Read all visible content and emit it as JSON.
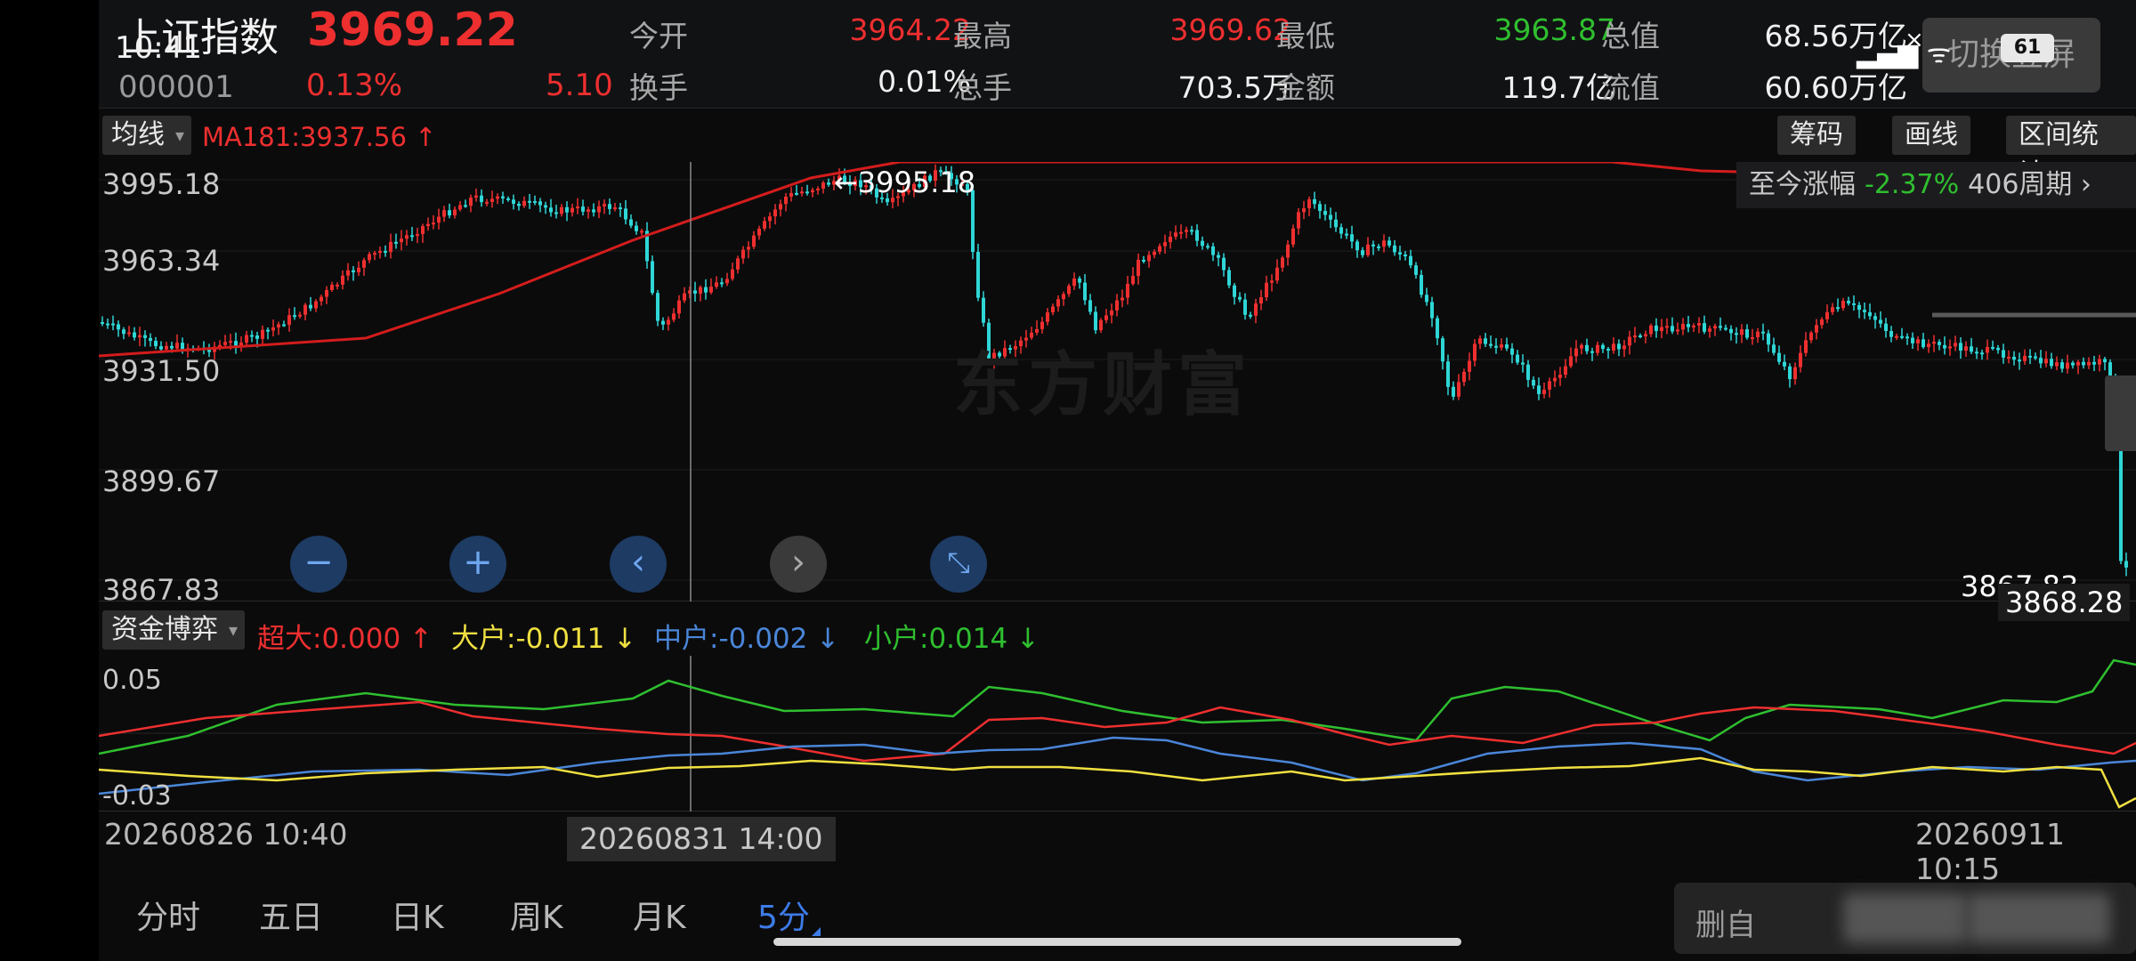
{
  "status_bar": {
    "time": "10:41",
    "battery": "61"
  },
  "header": {
    "name": "上证指数",
    "price": "3969.22",
    "code": "000001",
    "change_pct": "0.13%",
    "change": "5.10",
    "quotes": [
      {
        "label": "今开",
        "value": "3964.22",
        "color": "red"
      },
      {
        "label": "最高",
        "value": "3969.62",
        "color": "red"
      },
      {
        "label": "最低",
        "value": "3963.87",
        "color": "green"
      },
      {
        "label": "总值",
        "value": "68.56万亿",
        "color": "white"
      },
      {
        "label": "换手",
        "value": "0.01%",
        "color": "white"
      },
      {
        "label": "总手",
        "value": "703.5万",
        "color": "white"
      },
      {
        "label": "金额",
        "value": "119.7亿",
        "color": "white"
      },
      {
        "label": "流值",
        "value": "60.60万亿",
        "color": "white"
      }
    ],
    "fullscreen_button": "切换竖屏"
  },
  "toolbar": {
    "ma_button": "均线",
    "ma_label": "MA181:3937.56 ↑",
    "tools": [
      "筹码",
      "画线",
      "区间统计"
    ]
  },
  "main_chart": {
    "y_labels": [
      "3995.18",
      "3963.34",
      "3931.50",
      "3899.67",
      "3867.83"
    ],
    "max_annotation": "←3995.18",
    "low_annotation": "3867.83",
    "current_price_tag": "3868.28",
    "range_change_label": "至今涨幅",
    "range_change_value": "-2.37%",
    "range_period": "406周期 ›",
    "watermark": "东方财富",
    "controls": {
      "zoom_out": "−",
      "zoom_in": "+",
      "prev": "‹",
      "next": "›",
      "collapse": "⤡"
    }
  },
  "indicator": {
    "button": "资金博弈",
    "labels": [
      {
        "text": "超大:0.000 ↑",
        "color": "#ee2f2f"
      },
      {
        "text": "大户:-0.011 ↓",
        "color": "#f0e040"
      },
      {
        "text": "中户:-0.002 ↓",
        "color": "#4a86d8"
      },
      {
        "text": "小户:0.014 ↓",
        "color": "#2fbf2f"
      }
    ],
    "y_labels": [
      "0.05",
      "-0.03"
    ]
  },
  "x_axis": {
    "start": "20260826 10:40",
    "cursor": "20260831 14:00",
    "end": "20260911 10:15"
  },
  "period_tabs": {
    "items": [
      "分时",
      "五日",
      "日K",
      "周K",
      "月K",
      "5分"
    ],
    "active": "5分"
  },
  "bottom": {
    "delete_label": "删自"
  },
  "colors": {
    "up": "#ee2f2f",
    "down": "#2fd6d6",
    "ma": "#d41c1c",
    "super": "#ee2f2f",
    "large": "#f0e040",
    "medium": "#4a86d8",
    "small": "#2fbf2f"
  }
}
